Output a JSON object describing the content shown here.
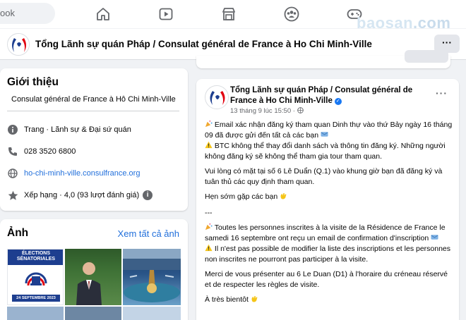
{
  "topnav": {
    "search_placeholder": "ook",
    "watermark_left": "baosan",
    "watermark_right": ".com"
  },
  "page": {
    "name": "Tổng Lãnh sự quán Pháp / Consulat général de France à Ho Chi Minh-Ville",
    "more_label": "···"
  },
  "intro": {
    "title": "Giới thiệu",
    "bio": "Consulat général de France à Hô Chi Minh-Ville",
    "category": "Trang · Lãnh sự & Đại sứ quán",
    "phone": "028 3520 6800",
    "website": "ho-chi-minh-ville.consulfrance.org",
    "rating": "Xếp hạng · 4,0 (93 lượt đánh giá)",
    "rating_info": "i"
  },
  "photos": {
    "title": "Ảnh",
    "see_all": "Xem tất cả ảnh",
    "thumb1_line1": "ÉLECTIONS",
    "thumb1_line2": "SÉNATORIALES",
    "thumb1_date": "24 SEPTEMBRE 2023"
  },
  "post": {
    "author": "Tổng Lãnh sự quán Pháp / Consulat général de France à Ho Chi Minh-Ville",
    "time": "13 tháng 9 lúc 15:50 · ",
    "more_label": "···",
    "p1": "Email xác nhận đăng ký tham quan Dinh thự vào thứ Bảy ngày 16 tháng 09 đã được gửi đến tất cả các bạn",
    "p1b": "BTC không thể thay đổi danh sách và thông tin đăng ký. Những người không đăng ký sẽ không thể tham gia tour tham quan.",
    "p2": "Vui lòng có mặt tại số 6 Lê Duẩn (Q.1) vào khung giờ bạn đã đăng ký và tuân thủ các quy định tham quan.",
    "p3": "Hẹn sớm gặp các bạn",
    "divider": "---",
    "p4": "Toutes les personnes inscrites à la visite de la Résidence de France le samedi 16 septembre ont reçu un email de confirmation d'inscription",
    "p4b": "Il n'est pas possible de modifier la liste des inscriptions et les personnes non inscrites ne pourront pas participer à la visite.",
    "p5": "Merci de vous présenter au 6 Le Duan (D1) à l'horaire du créneau réservé et de respecter les règles de visite.",
    "p6": "À très bientôt"
  },
  "colors": {
    "link": "#216fdb",
    "fb_blue": "#1877f2",
    "france_blue": "#1d3e8f",
    "france_red": "#e1000f"
  }
}
